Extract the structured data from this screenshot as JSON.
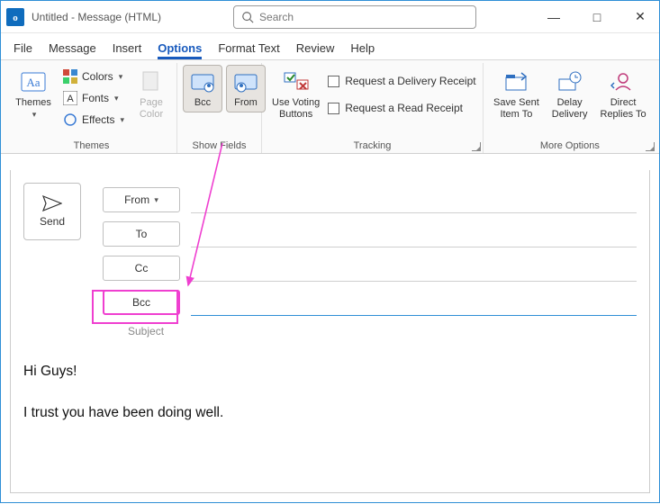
{
  "titlebar": {
    "app_initial": "o",
    "title": "Untitled  -  Message (HTML)",
    "search_placeholder": "Search"
  },
  "tabs": {
    "file": "File",
    "message": "Message",
    "insert": "Insert",
    "options": "Options",
    "format_text": "Format Text",
    "review": "Review",
    "help": "Help"
  },
  "ribbon": {
    "themes": {
      "themes_label": "Themes",
      "colors": "Colors",
      "fonts": "Fonts",
      "effects": "Effects",
      "page_color": "Page\nColor",
      "group_label": "Themes"
    },
    "show_fields": {
      "bcc": "Bcc",
      "from": "From",
      "group_label": "Show Fields"
    },
    "tracking": {
      "use_voting": "Use Voting\nButtons",
      "delivery": "Request a Delivery Receipt",
      "read": "Request a Read Receipt",
      "group_label": "Tracking"
    },
    "more": {
      "save_sent": "Save Sent\nItem To",
      "delay": "Delay\nDelivery",
      "direct": "Direct\nReplies To",
      "group_label": "More Options"
    }
  },
  "compose": {
    "send": "Send",
    "from": "From",
    "to": "To",
    "cc": "Cc",
    "bcc": "Bcc",
    "subject_label": "Subject"
  },
  "body": {
    "line1": "Hi Guys!",
    "line2": "I trust you have been doing well."
  },
  "annotation": {
    "color": "#ef3fd0"
  }
}
